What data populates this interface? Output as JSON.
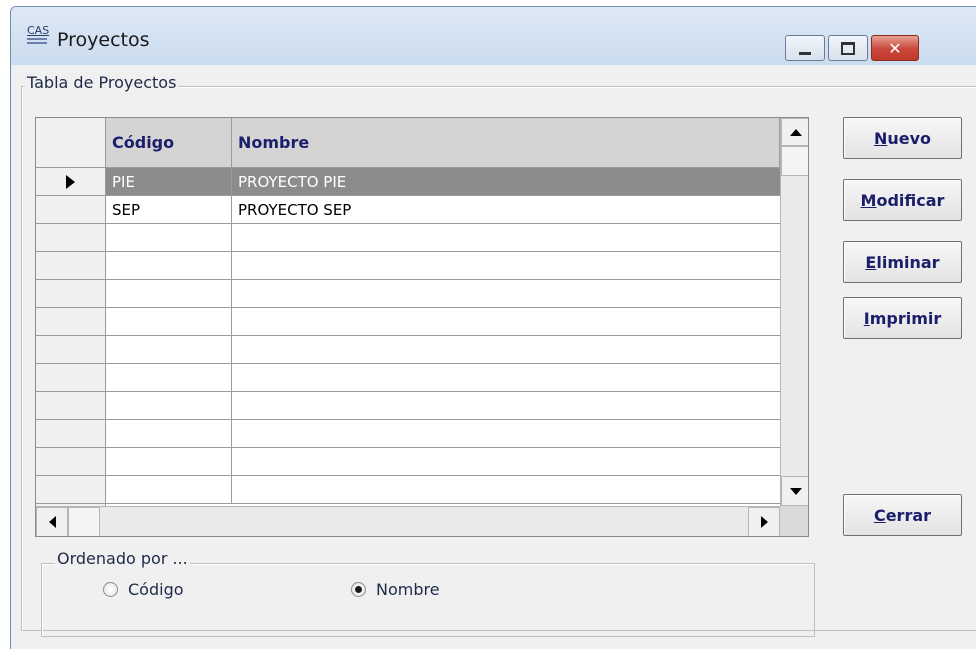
{
  "window": {
    "icon_text": "CAS",
    "title": "Proyectos"
  },
  "table_group": {
    "legend": "Tabla de Proyectos"
  },
  "grid": {
    "columns": [
      "Código",
      "Nombre"
    ],
    "rows": [
      {
        "codigo": "PIE",
        "nombre": "PROYECTO PIE",
        "selected": true
      },
      {
        "codigo": "SEP",
        "nombre": "PROYECTO SEP",
        "selected": false
      }
    ],
    "empty_rows": 10
  },
  "buttons": {
    "nuevo": {
      "mnemonic": "N",
      "rest": "uevo"
    },
    "modificar": {
      "mnemonic": "M",
      "rest": "odificar"
    },
    "eliminar": {
      "mnemonic": "E",
      "rest": "liminar"
    },
    "imprimir": {
      "mnemonic": "I",
      "rest": "mprimir"
    },
    "cerrar": {
      "mnemonic": "C",
      "rest": "errar"
    }
  },
  "order_group": {
    "legend": "Ordenado por ...",
    "options": [
      {
        "label": "Código",
        "checked": false
      },
      {
        "label": "Nombre",
        "checked": true
      }
    ]
  },
  "colors": {
    "title_bar": "#d4e2f2",
    "selected_row": "#8c8c8c",
    "header_text": "#1b1f6b",
    "close_button": "#c9463a"
  }
}
